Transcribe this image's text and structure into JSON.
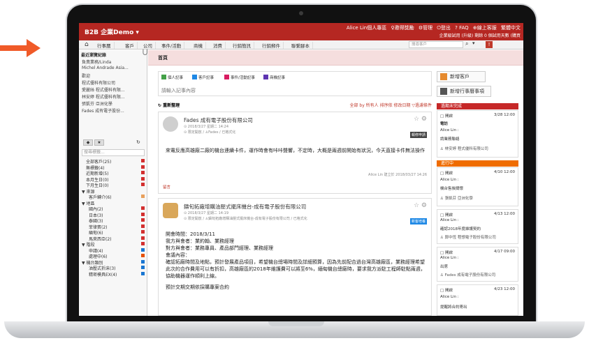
{
  "brand": "B2B 企業Demo",
  "user_links": [
    "Alice Lin個人專區",
    "♀邀得獎勵",
    "⚙管理",
    "⏻登出",
    "? FAQ",
    "⊕線上客服",
    "繁體中文"
  ],
  "org_line": "企業級試用 (升級)  剩餘 0 個試用天數 (購買",
  "nav_items": [
    "行事曆",
    "客戶",
    "公司",
    "事件/活動",
    "商機",
    "消費",
    "行銷簡訊",
    "行銷郵件",
    "聯繫腳本"
  ],
  "search_placeholder": "搜尋客戶",
  "sidebar": {
    "recent_title": "最近瀏覽紀錄",
    "recent": [
      "負責業務/Linda",
      "Michel Andrade Asia...",
      "歡迎",
      "程式優科有限公司",
      "愛麗絲 程式優科有限...",
      "林安婷 程式優科有限...",
      "張凱芬 亞洲化學",
      "Fades 成有電子股份..."
    ],
    "search_placeholder": "搜尋標籤...",
    "filters": [
      "全部客戶(25)",
      "無標籤(4)",
      "近期新增(5)",
      "本月生日(0)",
      "下月生日(0)",
      "▼ 來源",
      "客戶轉介(6)",
      "▼ 地區",
      "國內(2)",
      "日本(3)",
      "泰國(3)",
      "菲律賓(2)",
      "緬甸(6)",
      "馬來西亞(2)",
      "▼ 階段",
      "申請(4)",
      "處理中(6)",
      "▼ 機台類別",
      "油壓式折床(3)",
      "精密模具EX(4)"
    ]
  },
  "breadcrumb": "首頁",
  "composer": {
    "tabs": [
      "個人記事",
      "客戶記事",
      "事件/活動記事",
      "商機記事"
    ],
    "placeholder": "請輸入記事內容"
  },
  "feed": {
    "title": "重新整理",
    "controls": "全部 by 所有人 排序依 修改日期 ▽過濾條件"
  },
  "posts": [
    {
      "title": "Fades 成有電子股份有限公司",
      "meta1": "⊙ 2018/3/27 星期二 14:24",
      "meta2": "⊙ 限定開放 / ♙Fades / 已格式化",
      "badge": "報修申請",
      "body": "來電反應高雄廠二廠的機台連續卡件，運作時會有咔咔聲響，不定時，大概是兩週前開始有狀況，今天直接卡件無法操作",
      "footer": "Alice Lin 建立於 2018/03/27 14:26",
      "reply": "留言"
    },
    {
      "title": "鑄旬拓廠增購油壓式擺床機台-成有電子股份有限公司",
      "meta1": "⊙ 2018/3/27 星期二 14:19",
      "meta2": "⊙ 限定開放 / ♙鑄旬拓廠增購油壓式擺床機台-成有電子股份有限公司 / 已格式化",
      "badge": "新客培養",
      "body_lines": [
        "開會時間：2018/3/11",
        "我方與會者：業約翰、業務經理",
        "對方與會者：業務專員、產品部門經理、業務經理",
        "會議內容：",
        "確認拓廠時間及地點，預計發展產品項目，希望機台總場時間及詳細預算，因為先前配合過台灣高雄廠區，業務經理希望此次的合作費用可以有折扣，高雄廠區的2018年維護費可以將至6%，緬甸機台總廠時，要求我方派駐工程師駐點兩週，協助機器運作順利上線。",
        "",
        "預計交期交期依採購專案合約"
      ]
    }
  ],
  "right": {
    "btn_new_customer": "新增客戶",
    "btn_new_event": "新增行事曆事項",
    "section_overdue": "過期未完成",
    "section_ongoing": "進行中",
    "overdue_card": {
      "status": "□ 開啟",
      "date": "3/28 12:00",
      "tag": "電訪",
      "who": "Alice Lin :",
      "text": "請業務聯絡",
      "owner": "♙ 林安婷 程式優科有限公司"
    },
    "ongoing_cards": [
      {
        "status": "□ 開啟",
        "date": "4/10 12:00",
        "who": "Alice Lin :",
        "text": "機台售後關懷",
        "owner": "♙ 張凱芬 亞洲化學"
      },
      {
        "status": "□ 開啟",
        "date": "4/13 12:00",
        "who": "Alice Lin :",
        "text": "確認2018年度維護契約",
        "owner": "♙ 鄭中恆 程想電子股份有限公司"
      },
      {
        "status": "□ 開啟",
        "date": "4/17 09:00",
        "who": "Alice Lin :",
        "text": "出席",
        "owner": "♙ Fades 成有電子股份有限公司"
      },
      {
        "status": "□ 開啟",
        "date": "4/23 12:00",
        "who": "Alice Lin :",
        "text": "提醒將合約寄出",
        "owner": ""
      }
    ]
  },
  "colors": {
    "brand_red": "#b52722",
    "accent_orange": "#e68a2e",
    "arrow": "#f05a28"
  }
}
